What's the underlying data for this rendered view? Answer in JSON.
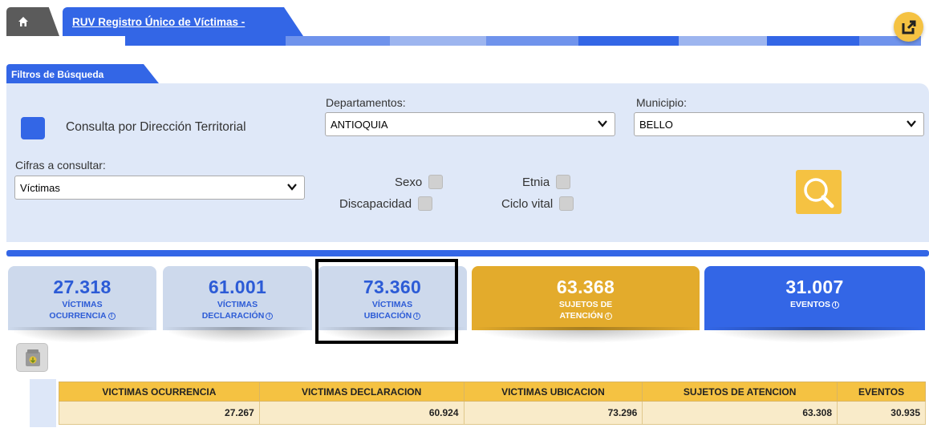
{
  "header": {
    "home_icon": "home-icon",
    "tab_title": "RUV Registro Único de Víctimas -",
    "external_icon": "external-link-icon"
  },
  "filters": {
    "tab_label": "Filtros de Búsqueda",
    "territorial_label": "Consulta por Dirección Territorial",
    "departamentos_label": "Departamentos:",
    "departamento_value": "ANTIOQUIA",
    "municipio_label": "Municipio:",
    "municipio_value": "BELLO",
    "cifras_label": "Cifras a consultar:",
    "cifras_value": "Víctimas",
    "checkboxes": {
      "sexo": "Sexo",
      "etnia": "Etnia",
      "discapacidad": "Discapacidad",
      "ciclo_vital": "Ciclo vital"
    }
  },
  "cards": [
    {
      "value": "27.318",
      "line1": "VÍCTIMAS",
      "line2": "OCURRENCIA"
    },
    {
      "value": "61.001",
      "line1": "VÍCTIMAS",
      "line2": "DECLARACIÓN"
    },
    {
      "value": "73.360",
      "line1": "VÍCTIMAS",
      "line2": "UBICACIÓN"
    },
    {
      "value": "63.368",
      "line1": "SUJETOS DE",
      "line2": "ATENCIÓN"
    },
    {
      "value": "31.007",
      "line1": "EVENTOS",
      "line2": ""
    }
  ],
  "table": {
    "headers": [
      "VICTIMAS OCURRENCIA",
      "VICTIMAS DECLARACION",
      "VICTIMAS UBICACION",
      "SUJETOS DE ATENCION",
      "EVENTOS"
    ],
    "row": [
      "27.267",
      "60.924",
      "73.296",
      "63.308",
      "30.935"
    ]
  },
  "colors": {
    "brand_blue": "#3366e6",
    "accent_yellow": "#f5c242",
    "card_light": "#cdd9ec",
    "card_yellow": "#e3ab2c"
  }
}
